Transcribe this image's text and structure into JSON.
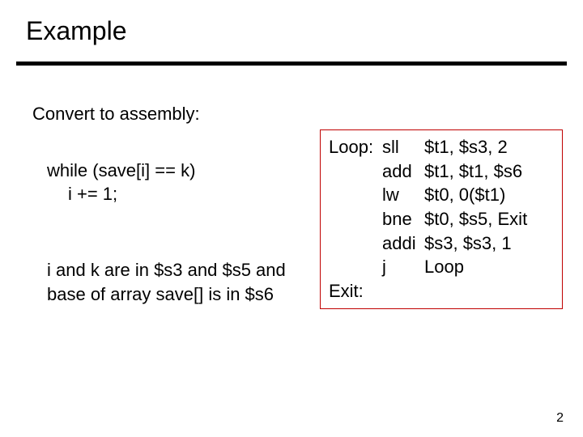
{
  "title": "Example",
  "left": {
    "line1": "Convert to assembly:",
    "line2": "while   (save[i] == k)",
    "line3": "i += 1;",
    "line4": "i and k are in $s3 and $s5 and",
    "line5": "base of array save[] is in $s6"
  },
  "code": {
    "labels": {
      "loop": "Loop:",
      "exit": "Exit:"
    },
    "rows": [
      {
        "label": "Loop:",
        "op": "sll",
        "args": "$t1, $s3, 2"
      },
      {
        "label": "",
        "op": "add",
        "args": "$t1, $t1, $s6"
      },
      {
        "label": "",
        "op": "lw",
        "args": "$t0, 0($t1)"
      },
      {
        "label": "",
        "op": "bne",
        "args": "$t0, $s5, Exit"
      },
      {
        "label": "",
        "op": "addi",
        "args": "$s3, $s3, 1"
      },
      {
        "label": "",
        "op": "j",
        "args": "Loop"
      },
      {
        "label": "Exit:",
        "op": "",
        "args": ""
      }
    ]
  },
  "page_number": "2"
}
